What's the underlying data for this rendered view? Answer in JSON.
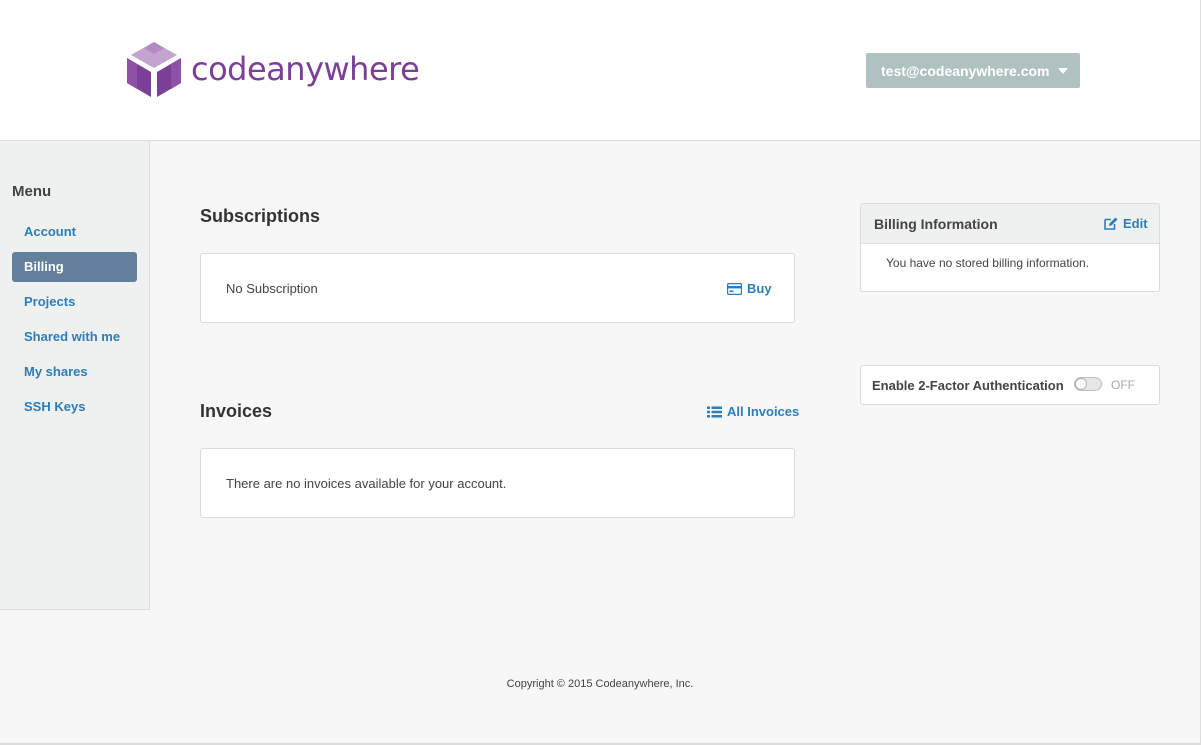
{
  "brand": {
    "name": "codeanywhere",
    "colors": {
      "logo_dark": "#7b3f98",
      "logo_light": "#c5a3cf",
      "link": "#2c7db8",
      "active_menu": "#62809c",
      "user_menu_bg": "#b0c1c1"
    }
  },
  "header": {
    "user_email": "test@codeanywhere.com",
    "dropdown_icon": "caret-down-icon"
  },
  "sidebar": {
    "title": "Menu",
    "items": [
      {
        "label": "Account",
        "active": false
      },
      {
        "label": "Billing",
        "active": true
      },
      {
        "label": "Projects",
        "active": false
      },
      {
        "label": "Shared with me",
        "active": false
      },
      {
        "label": "My shares",
        "active": false
      },
      {
        "label": "SSH Keys",
        "active": false
      }
    ]
  },
  "subscriptions": {
    "title": "Subscriptions",
    "status": "No Subscription",
    "buy_label": "Buy",
    "buy_icon": "credit-card-icon"
  },
  "invoices": {
    "title": "Invoices",
    "all_label": "All Invoices",
    "all_icon": "list-icon",
    "empty_message": "There are no invoices available for your account."
  },
  "billing_info": {
    "title": "Billing Information",
    "edit_label": "Edit",
    "edit_icon": "edit-icon",
    "message": "You have no stored billing information."
  },
  "two_factor": {
    "label": "Enable 2-Factor Authentication",
    "state": "OFF",
    "enabled": false
  },
  "footer": {
    "copyright": "Copyright © 2015 Codeanywhere, Inc."
  }
}
